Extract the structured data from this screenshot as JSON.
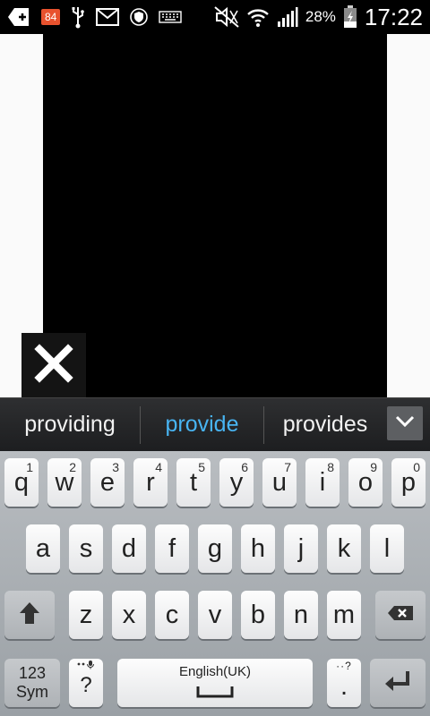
{
  "status_bar": {
    "notification_count": "84",
    "battery_percent": "28%",
    "time": "17:22",
    "icons": [
      "add-notification-icon",
      "notification-badge",
      "usb-icon",
      "gmail-icon",
      "shield-icon",
      "keyboard-icon",
      "mute-icon",
      "wifi-icon",
      "signal-icon",
      "battery-charging-icon"
    ]
  },
  "suggestions": {
    "items": [
      "providing",
      "provide",
      "provides"
    ],
    "highlight_color": "#48b4f2"
  },
  "keyboard": {
    "row1": [
      {
        "key": "q",
        "hint": "1"
      },
      {
        "key": "w",
        "hint": "2"
      },
      {
        "key": "e",
        "hint": "3"
      },
      {
        "key": "r",
        "hint": "4"
      },
      {
        "key": "t",
        "hint": "5"
      },
      {
        "key": "y",
        "hint": "6"
      },
      {
        "key": "u",
        "hint": "7"
      },
      {
        "key": "i",
        "hint": "8"
      },
      {
        "key": "o",
        "hint": "9"
      },
      {
        "key": "p",
        "hint": "0"
      }
    ],
    "row2": [
      "a",
      "s",
      "d",
      "f",
      "g",
      "h",
      "j",
      "k",
      "l"
    ],
    "row3": [
      "z",
      "x",
      "c",
      "v",
      "b",
      "n",
      "m"
    ],
    "sym_label_1": "123",
    "sym_label_2": "Sym",
    "question_key": "?",
    "space_label": "English(UK)",
    "period_key": ".",
    "period_hint": "?"
  }
}
